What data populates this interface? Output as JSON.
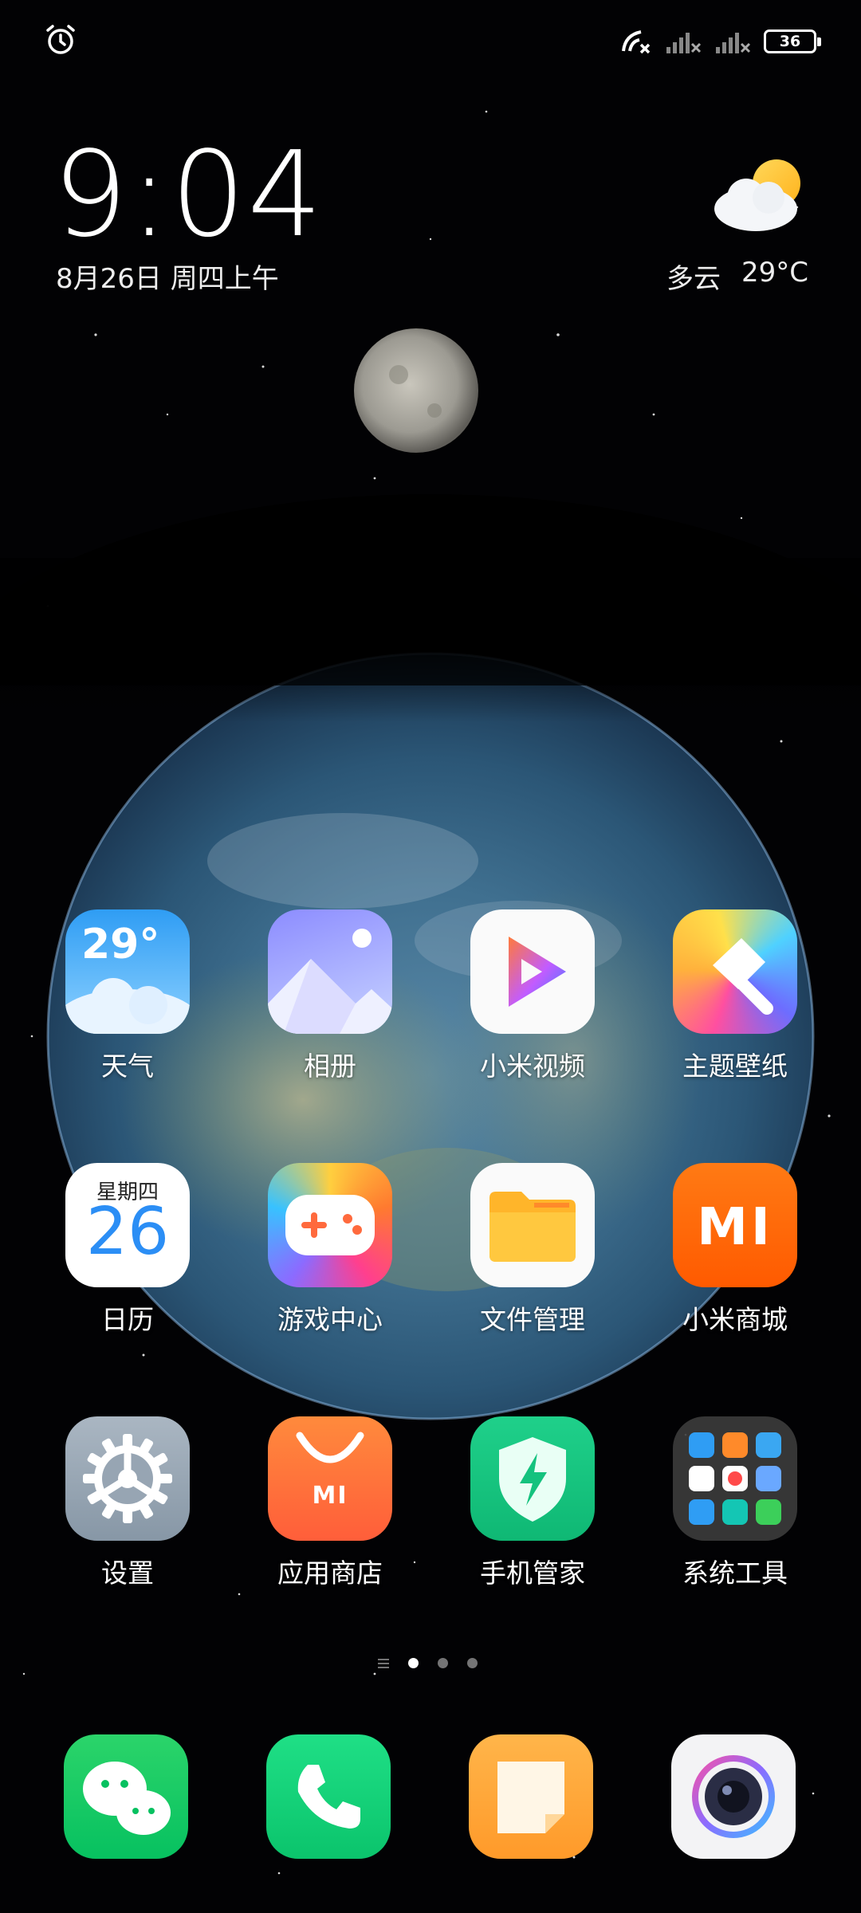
{
  "status_bar": {
    "battery_level": "36",
    "icons": [
      "alarm-icon",
      "hotspot-off-icon",
      "signal-1-icon",
      "signal-2-icon",
      "battery-icon"
    ]
  },
  "clock": {
    "time": "9:04",
    "date": "8月26日 周四上午"
  },
  "weather_widget": {
    "condition": "多云",
    "temperature": "29°C",
    "icon": "partly-cloudy-icon"
  },
  "apps": [
    {
      "id": "weather",
      "label": "天气",
      "icon": "weather-icon",
      "badge": "29°"
    },
    {
      "id": "gallery",
      "label": "相册",
      "icon": "gallery-icon"
    },
    {
      "id": "mi-video",
      "label": "小米视频",
      "icon": "video-play-icon"
    },
    {
      "id": "themes",
      "label": "主题壁纸",
      "icon": "themes-brush-icon"
    },
    {
      "id": "calendar",
      "label": "日历",
      "icon": "calendar-icon",
      "weekday": "星期四",
      "day": "26"
    },
    {
      "id": "game-center",
      "label": "游戏中心",
      "icon": "gamepad-icon"
    },
    {
      "id": "file-manager",
      "label": "文件管理",
      "icon": "folder-icon"
    },
    {
      "id": "mi-store",
      "label": "小米商城",
      "icon": "mi-logo-icon",
      "logo_text": "MI"
    },
    {
      "id": "settings",
      "label": "设置",
      "icon": "gear-icon"
    },
    {
      "id": "app-store",
      "label": "应用商店",
      "icon": "shopping-bag-icon",
      "logo_text": "MI"
    },
    {
      "id": "security",
      "label": "手机管家",
      "icon": "shield-bolt-icon"
    },
    {
      "id": "system-tools",
      "label": "系统工具",
      "icon": "folder-grid-icon"
    }
  ],
  "page_indicator": {
    "pages": 3,
    "current": 1
  },
  "dock": [
    {
      "id": "wechat",
      "icon": "wechat-icon"
    },
    {
      "id": "phone",
      "icon": "phone-icon"
    },
    {
      "id": "notes",
      "icon": "notes-icon"
    },
    {
      "id": "camera",
      "icon": "camera-icon"
    }
  ],
  "colors": {
    "weather_bg": "#3aa7f2",
    "store_orange": "#ff6a00",
    "security_green": "#15c27e",
    "settings_gray": "#9aa7b4"
  }
}
